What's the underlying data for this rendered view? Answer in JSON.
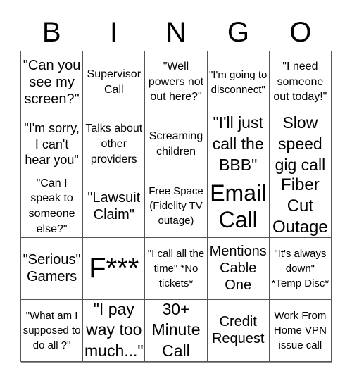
{
  "header": {
    "letters": [
      "B",
      "I",
      "N",
      "G",
      "O"
    ]
  },
  "rows": [
    [
      "\"Can you see my screen?\"",
      "Supervisor Call",
      "\"Well powers not out here?\"",
      "\"I'm going to disconnect\"",
      "\"I need someone out today!\""
    ],
    [
      "\"I'm sorry, I can't hear you\"",
      "Talks about other providers",
      "Screaming children",
      "\"I'll just call the BBB\"",
      "Slow speed gig call"
    ],
    [
      "\"Can I speak to someone else?\"",
      "\"Lawsuit Claim\"",
      "Free Space (Fidelity TV outage)",
      "Email Call",
      "Fiber Cut Outage"
    ],
    [
      "\"Serious\" Gamers",
      "F***",
      "\"I call all the time\" *No tickets*",
      "Mentions Cable One",
      "\"It's always down\" *Temp Disc*"
    ],
    [
      "\"What am I supposed to do all ?\"",
      "\"I pay way too much...\"",
      "30+ Minute Call",
      "Credit Request",
      "Work From Home VPN issue call"
    ]
  ]
}
